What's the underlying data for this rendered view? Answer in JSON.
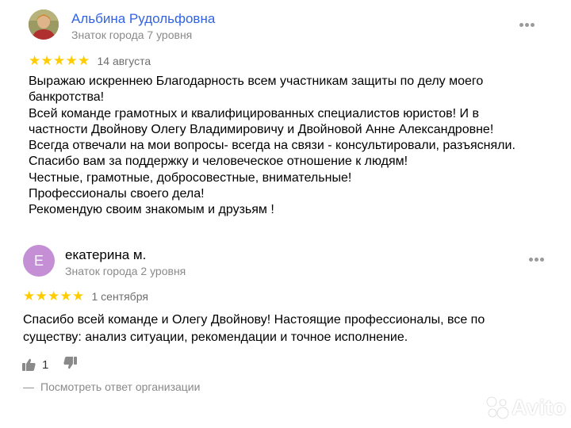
{
  "reviews": [
    {
      "author": {
        "name": "Альбина Рудольфовна",
        "level": "Знаток города 7 уровня",
        "avatar": "photo"
      },
      "rating": 5,
      "stars": "★★★★★",
      "date": "14 августа",
      "text_lines": [
        "Выражаю искренне­ю Благодарность всем участникам защиты по делу моего",
        "банкротства!",
        "Всей команде грамотных и квалифицированных специалистов юристов! И в",
        "частности Двойнову Олегу Владимировичу и Двойновой Анне Александровне!",
        "Всегда отвечали на мои вопросы- всегда на связи - консультировали, разъясняли.",
        "Спасибо вам за поддержку и человеческое отношение к людям!",
        "Честные, грамотные, добросовестные, внимательные!",
        "Профессионалы своего дела!",
        "Рекомендую своим знакомым и друзьям !"
      ]
    },
    {
      "author": {
        "name": "екатерина м.",
        "level": "Знаток города 2 уровня",
        "avatar_letter": "Е"
      },
      "rating": 5,
      "stars": "★★★★★",
      "date": "1 сентября",
      "text_lines": [
        "Спасибо всей команде и Олегу Двойнову! Настоящие профессионалы, все по",
        "существу: анализ ситуации, рекомендации и точное исполнение."
      ],
      "likes": "1",
      "org_answer_dash": "—",
      "org_answer_label": "Посмотреть ответ организации"
    }
  ],
  "watermark": "Avito",
  "colors": {
    "link_name": "#2f63e8",
    "star": "#ffcc00",
    "secondary_text": "#8a8a8a",
    "letter_avatar_bg": "#c48fd4"
  },
  "icons": {
    "more": "more-dots-icon",
    "like": "thumb-up-icon",
    "dislike": "thumb-down-icon",
    "watermark_logo": "avito-logo-icon"
  }
}
